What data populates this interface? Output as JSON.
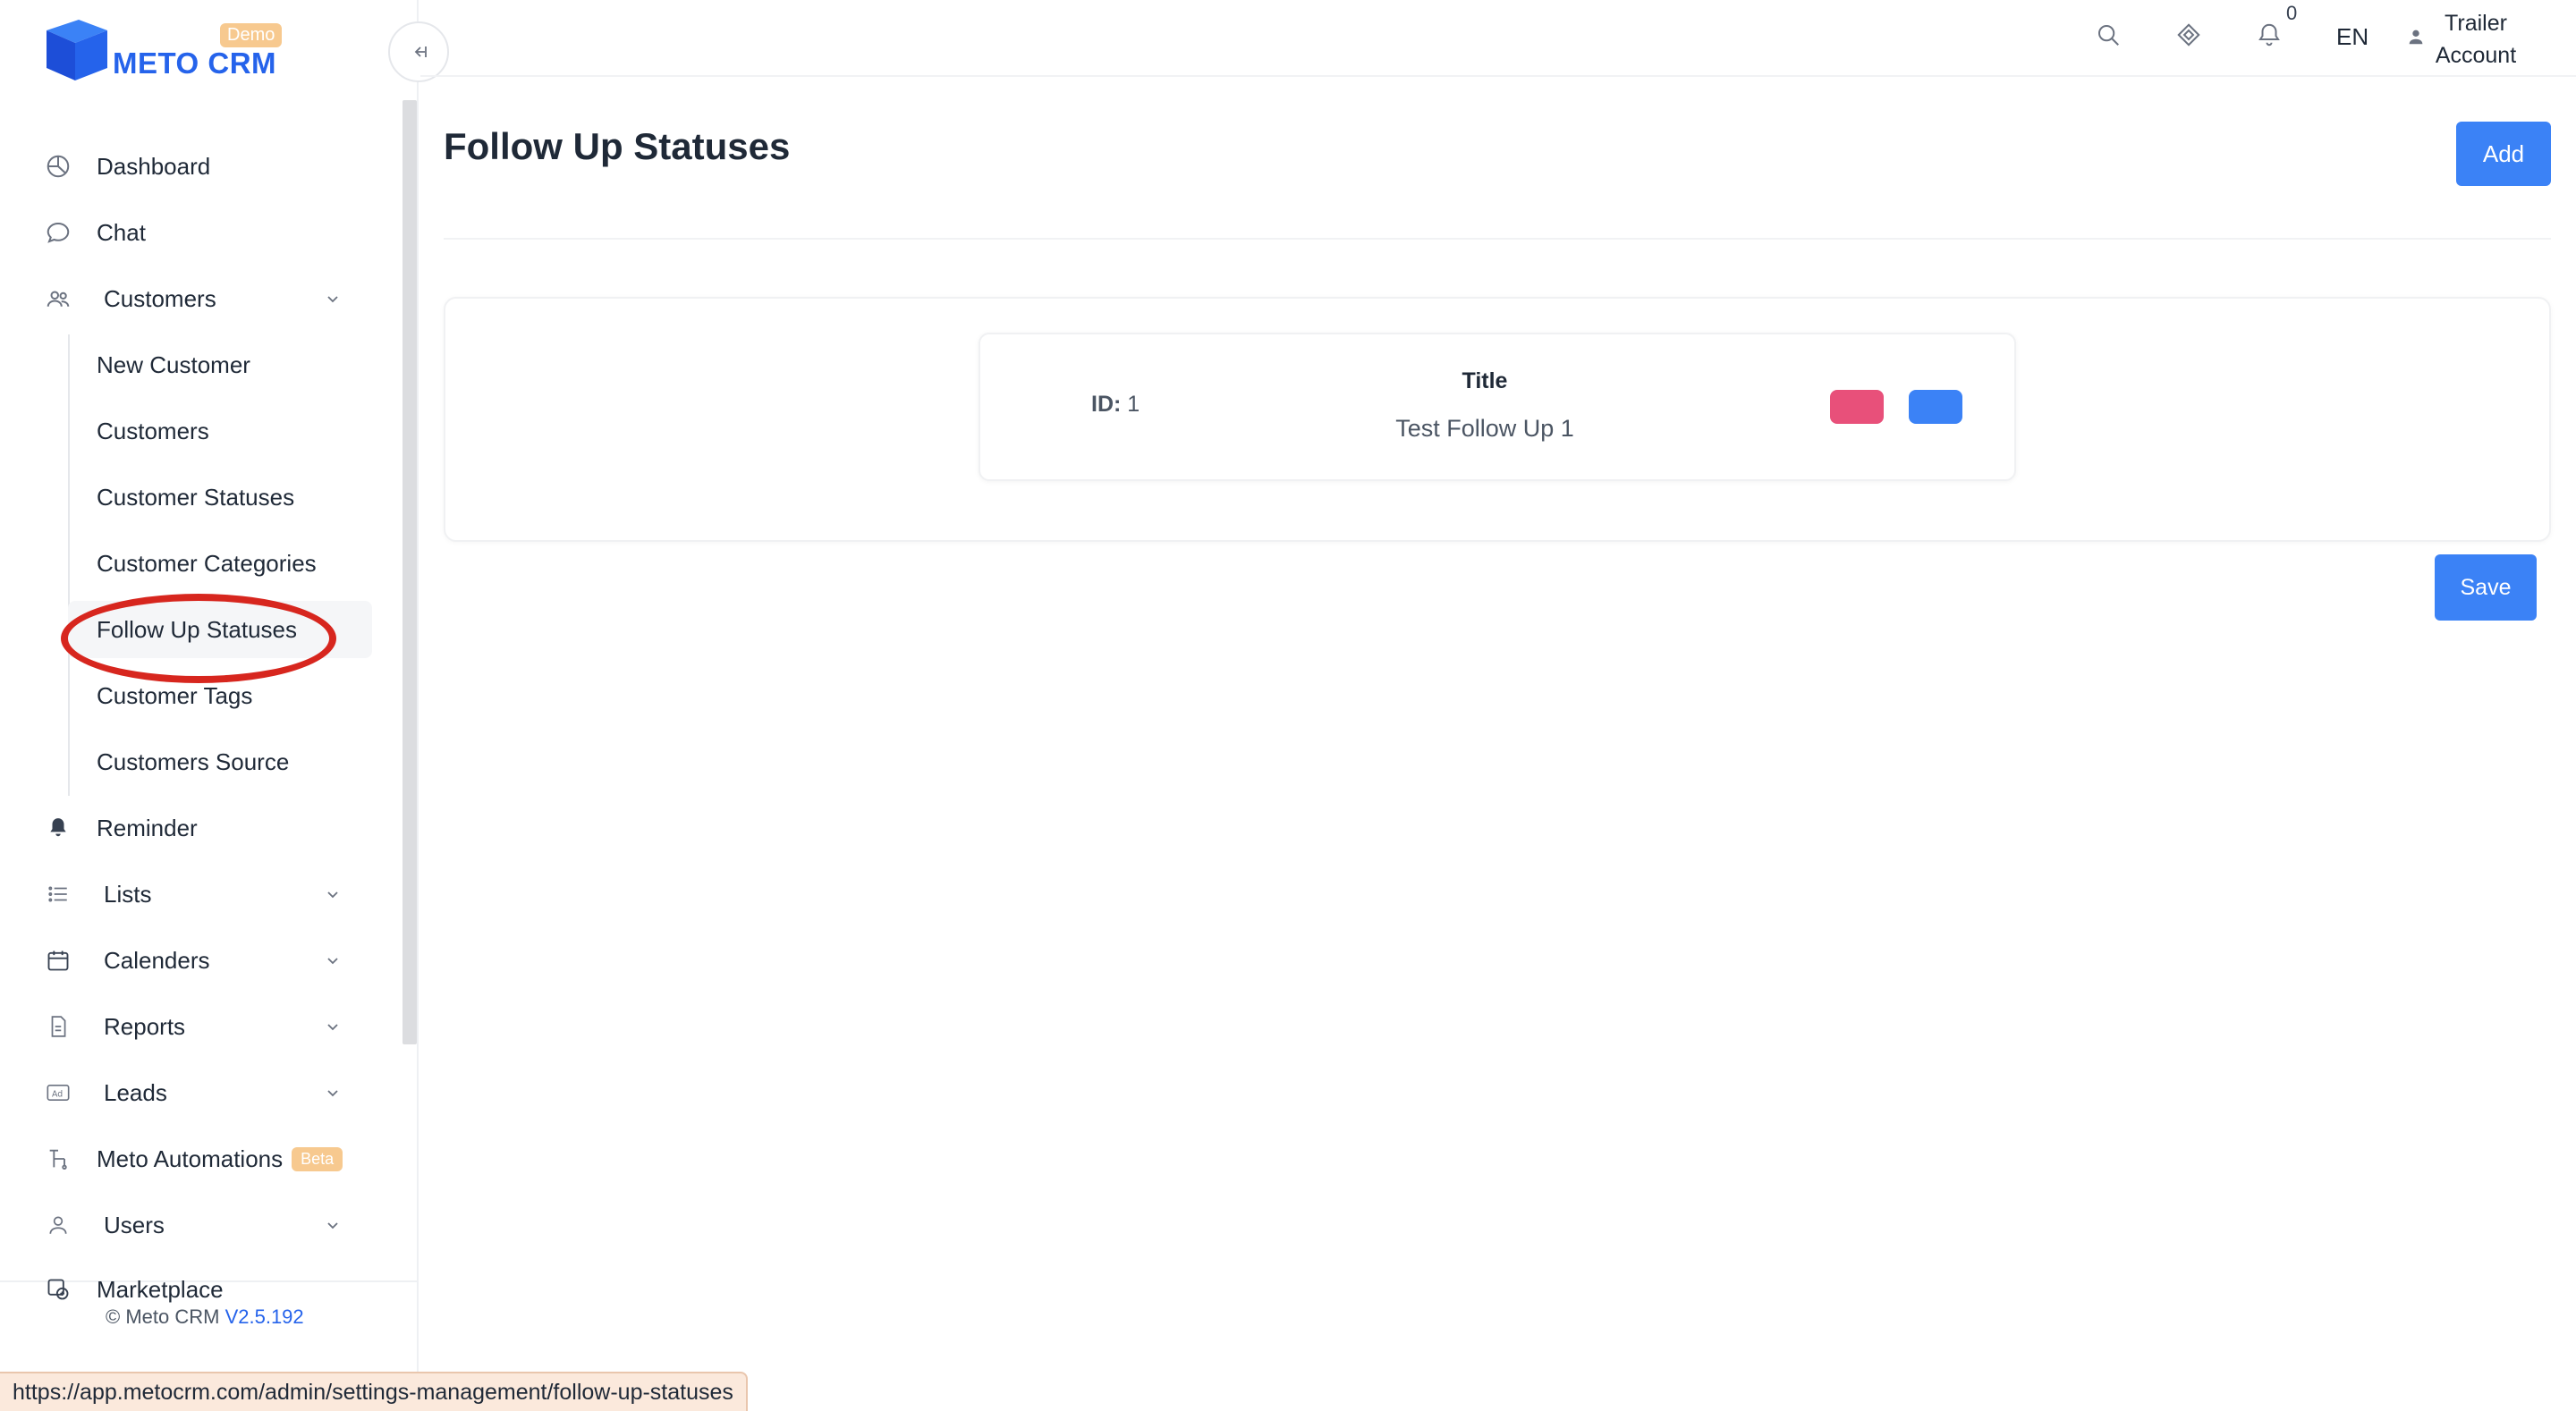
{
  "brand": {
    "name": "METO CRM",
    "badge": "Demo",
    "colors": {
      "primary": "#2563eb",
      "badge": "#f7c98f"
    }
  },
  "topbar": {
    "icons": [
      "search-icon",
      "diamond-icon",
      "bell-icon"
    ],
    "notification_count": "0",
    "language": "EN",
    "user": "Trailer Account"
  },
  "sidebar": {
    "items": [
      {
        "label": "Dashboard",
        "icon": "dashboard-icon"
      },
      {
        "label": "Chat",
        "icon": "chat-icon"
      },
      {
        "label": "Customers",
        "icon": "users-icon",
        "expandable": true,
        "expanded": true
      },
      {
        "label": "Reminder",
        "icon": "bell-icon"
      },
      {
        "label": "Lists",
        "icon": "list-icon",
        "expandable": true
      },
      {
        "label": "Calenders",
        "icon": "calendar-icon",
        "expandable": true
      },
      {
        "label": "Reports",
        "icon": "report-icon",
        "expandable": true
      },
      {
        "label": "Leads",
        "icon": "ad-icon",
        "expandable": true
      },
      {
        "label": "Meto Automations",
        "icon": "automation-icon",
        "badge": "Beta"
      },
      {
        "label": "Users",
        "icon": "user-icon",
        "expandable": true
      },
      {
        "label": "Marketplace",
        "icon": "marketplace-icon"
      }
    ],
    "customers_subitems": [
      {
        "label": "New Customer"
      },
      {
        "label": "Customers"
      },
      {
        "label": "Customer Statuses"
      },
      {
        "label": "Customer Categories"
      },
      {
        "label": "Follow Up Statuses",
        "active": true
      },
      {
        "label": "Customer Tags"
      },
      {
        "label": "Customers Source"
      }
    ],
    "copyright": "© Meto CRM",
    "version": "V2.5.192"
  },
  "main": {
    "title": "Follow Up Statuses",
    "add_label": "Add",
    "save_label": "Save",
    "records": [
      {
        "id_label": "ID:",
        "id": "1",
        "title_label": "Title",
        "title": "Test Follow Up 1"
      }
    ],
    "action_colors": {
      "delete": "#e8507a",
      "edit": "#3b82f6"
    }
  },
  "statusbar": {
    "url": "https://app.metocrm.com/admin/settings-management/follow-up-statuses"
  }
}
